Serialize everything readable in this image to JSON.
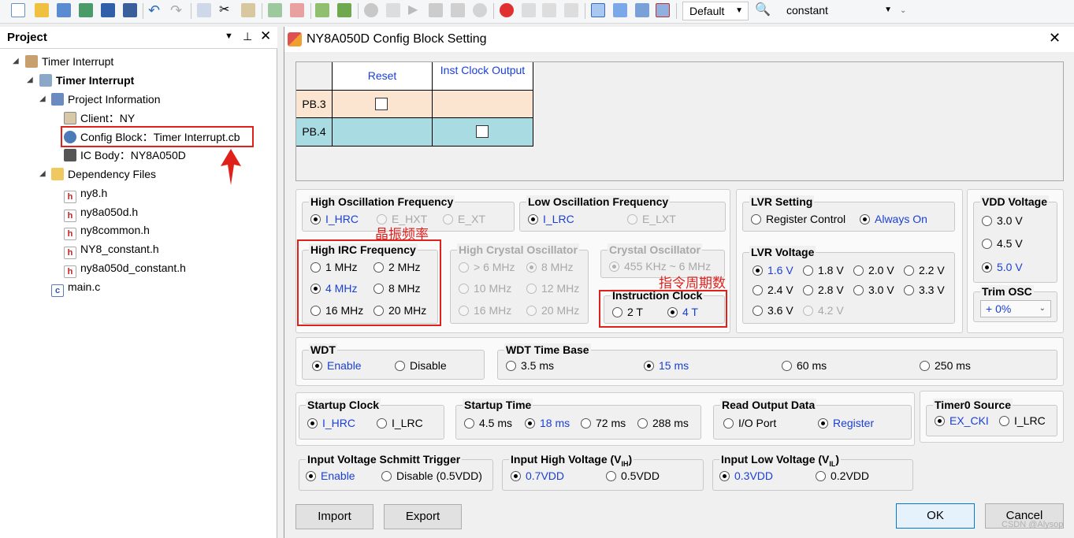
{
  "toolbar": {
    "config_combo": "Default",
    "search_combo": "constant"
  },
  "project": {
    "title": "Project",
    "items": [
      {
        "label": "Timer Interrupt"
      },
      {
        "label": "Timer Interrupt"
      },
      {
        "label": "Project Information"
      },
      {
        "label": "Client：NY"
      },
      {
        "label": "Config Block：Timer Interrupt.cb"
      },
      {
        "label": "IC Body：NY8A050D"
      },
      {
        "label": "Dependency Files"
      },
      {
        "label": "ny8.h"
      },
      {
        "label": "ny8a050d.h"
      },
      {
        "label": "ny8common.h"
      },
      {
        "label": "NY8_constant.h"
      },
      {
        "label": "ny8a050d_constant.h"
      },
      {
        "label": "main.c"
      }
    ]
  },
  "dialog": {
    "title": "NY8A050D Config Block Setting",
    "table": {
      "headers": [
        "Reset",
        "Inst Clock Output"
      ],
      "rows": [
        "PB.3",
        "PB.4"
      ]
    },
    "high_osc_freq": {
      "label": "High Oscillation Frequency",
      "options": [
        "I_HRC",
        "E_HXT",
        "E_XT"
      ]
    },
    "low_osc_freq": {
      "label": "Low Oscillation Frequency",
      "options": [
        "I_LRC",
        "E_LXT"
      ]
    },
    "lvr_setting": {
      "label": "LVR Setting",
      "options": [
        "Register Control",
        "Always On"
      ]
    },
    "vdd_voltage": {
      "label": "VDD Voltage",
      "options": [
        "3.0 V",
        "4.5 V",
        "5.0 V"
      ]
    },
    "high_irc_freq": {
      "label": "High IRC Frequency",
      "options": [
        "1 MHz",
        "2 MHz",
        "4 MHz",
        "8 MHz",
        "16 MHz",
        "20 MHz"
      ]
    },
    "high_crystal_osc": {
      "label": "High Crystal Oscillator",
      "options": [
        "> 6 MHz",
        "8 MHz",
        "10 MHz",
        "12 MHz",
        "16 MHz",
        "20 MHz"
      ]
    },
    "crystal_osc": {
      "label": "Crystal Oscillator",
      "options": [
        "455 KHz ~ 6 MHz"
      ]
    },
    "instruction_clock": {
      "label": "Instruction Clock",
      "options": [
        "2 T",
        "4 T"
      ]
    },
    "lvr_voltage": {
      "label": "LVR Voltage",
      "options": [
        "1.6 V",
        "1.8 V",
        "2.0 V",
        "2.2 V",
        "2.4 V",
        "2.8 V",
        "3.0 V",
        "3.3 V",
        "3.6 V",
        "4.2 V"
      ]
    },
    "trim_osc": {
      "label": "Trim OSC",
      "value": "+ 0%"
    },
    "wdt": {
      "label": "WDT",
      "options": [
        "Enable",
        "Disable"
      ]
    },
    "wdt_time_base": {
      "label": "WDT Time Base",
      "options": [
        "3.5 ms",
        "15 ms",
        "60 ms",
        "250 ms"
      ]
    },
    "startup_clock": {
      "label": "Startup Clock",
      "options": [
        "I_HRC",
        "I_LRC"
      ]
    },
    "startup_time": {
      "label": "Startup Time",
      "options": [
        "4.5 ms",
        "18 ms",
        "72 ms",
        "288 ms"
      ]
    },
    "read_output_data": {
      "label": "Read Output Data",
      "options": [
        "I/O Port",
        "Register"
      ]
    },
    "timer0_source": {
      "label": "Timer0 Source",
      "options": [
        "EX_CKI",
        "I_LRC"
      ]
    },
    "schmitt": {
      "label": "Input Voltage Schmitt Trigger",
      "options": [
        "Enable",
        "Disable (0.5VDD)"
      ]
    },
    "vih": {
      "label": "Input High Voltage (V",
      "sub": "IH",
      "close": ")",
      "options": [
        "0.7VDD",
        "0.5VDD"
      ]
    },
    "vil": {
      "label": "Input Low Voltage (V",
      "sub": "IL",
      "close": ")",
      "options": [
        "0.3VDD",
        "0.2VDD"
      ]
    },
    "buttons": {
      "import": "Import",
      "export": "Export",
      "ok": "OK",
      "cancel": "Cancel"
    }
  },
  "annotations": {
    "crystal_note": "晶振频率",
    "cycle_note": "指令周期数"
  },
  "watermark": "CSDN @Alysop"
}
